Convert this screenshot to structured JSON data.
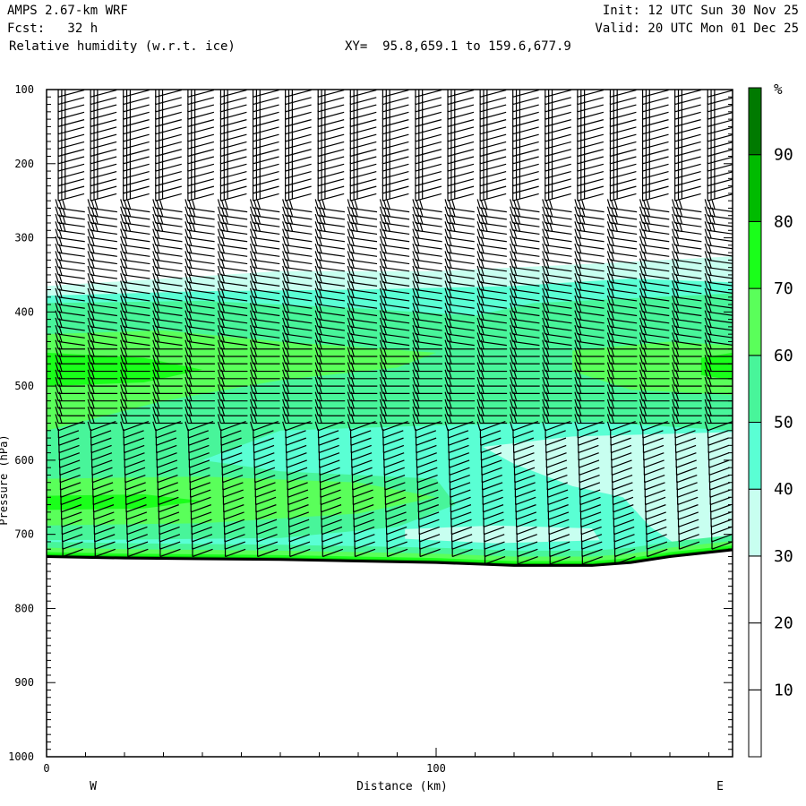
{
  "header": {
    "model": "AMPS 2.67-km WRF",
    "forecast": "Fcst:   32 h",
    "field": "Relative humidity (w.r.t. ice)",
    "xy": "XY=  95.8,659.1 to 159.6,677.9",
    "init": "Init: 12 UTC Sun 30 Nov 25",
    "valid": "Valid: 20 UTC Mon 01 Dec 25"
  },
  "chart_data": {
    "type": "heatmap",
    "title": "Relative humidity (w.r.t. ice)",
    "xlabel": "Distance (km)",
    "ylabel": "Pressure (hPa)",
    "xlim": [
      0,
      176
    ],
    "ylim": [
      1000,
      100
    ],
    "x_ticks": [
      0,
      100
    ],
    "x_minor_step": 10,
    "y_ticks": [
      100,
      200,
      300,
      400,
      500,
      600,
      700,
      800,
      900,
      1000
    ],
    "y_minor_step": 10,
    "left_end_label": "W",
    "right_end_label": "E",
    "colorbar": {
      "unit": "%",
      "tick_labels": [
        "10",
        "20",
        "30",
        "40",
        "50",
        "60",
        "70",
        "80",
        "90"
      ],
      "levels": [
        {
          "range": [
            0,
            10
          ],
          "color": "#ffffff"
        },
        {
          "range": [
            10,
            20
          ],
          "color": "#ffffff"
        },
        {
          "range": [
            20,
            30
          ],
          "color": "#ffffff"
        },
        {
          "range": [
            30,
            40
          ],
          "color": "#c8fff0"
        },
        {
          "range": [
            40,
            50
          ],
          "color": "#5affd4"
        },
        {
          "range": [
            50,
            60
          ],
          "color": "#48f59a"
        },
        {
          "range": [
            60,
            70
          ],
          "color": "#5aff5a"
        },
        {
          "range": [
            70,
            80
          ],
          "color": "#1aff1a"
        },
        {
          "range": [
            80,
            90
          ],
          "color": "#00bb00"
        },
        {
          "range": [
            90,
            100
          ],
          "color": "#007a00"
        }
      ]
    },
    "rh_regions": [
      {
        "level": 35,
        "polygon": [
          [
            0,
            365
          ],
          [
            30,
            355
          ],
          [
            60,
            345
          ],
          [
            100,
            345
          ],
          [
            140,
            335
          ],
          [
            176,
            325
          ],
          [
            176,
            780
          ],
          [
            0,
            780
          ]
        ]
      },
      {
        "level": 45,
        "polygon": [
          [
            0,
            378
          ],
          [
            40,
            372
          ],
          [
            80,
            370
          ],
          [
            120,
            365
          ],
          [
            150,
            355
          ],
          [
            176,
            360
          ],
          [
            176,
            780
          ],
          [
            0,
            780
          ]
        ]
      },
      {
        "level": 35,
        "polygon": [
          [
            112,
            582
          ],
          [
            135,
            568
          ],
          [
            176,
            562
          ],
          [
            176,
            700
          ],
          [
            162,
            715
          ],
          [
            155,
            690
          ],
          [
            148,
            650
          ],
          [
            135,
            635
          ],
          [
            120,
            605
          ]
        ]
      },
      {
        "level": 35,
        "polygon": [
          [
            92,
            693
          ],
          [
            115,
            688
          ],
          [
            140,
            692
          ],
          [
            142,
            708
          ],
          [
            115,
            712
          ],
          [
            92,
            706
          ]
        ]
      },
      {
        "level": 55,
        "polygon": [
          [
            0,
            388
          ],
          [
            40,
            385
          ],
          [
            80,
            395
          ],
          [
            110,
            405
          ],
          [
            125,
            388
          ],
          [
            176,
            375
          ],
          [
            176,
            560
          ],
          [
            140,
            548
          ],
          [
            100,
            553
          ],
          [
            60,
            560
          ],
          [
            40,
            600
          ],
          [
            60,
            615
          ],
          [
            100,
            625
          ],
          [
            105,
            660
          ],
          [
            90,
            690
          ],
          [
            60,
            705
          ],
          [
            0,
            708
          ]
        ]
      },
      {
        "level": 65,
        "polygon": [
          [
            0,
            430
          ],
          [
            30,
            425
          ],
          [
            60,
            440
          ],
          [
            100,
            455
          ],
          [
            90,
            475
          ],
          [
            60,
            492
          ],
          [
            30,
            520
          ],
          [
            0,
            560
          ]
        ]
      },
      {
        "level": 65,
        "polygon": [
          [
            0,
            625
          ],
          [
            40,
            622
          ],
          [
            80,
            630
          ],
          [
            100,
            650
          ],
          [
            80,
            672
          ],
          [
            40,
            685
          ],
          [
            0,
            688
          ]
        ]
      },
      {
        "level": 65,
        "polygon": [
          [
            135,
            452
          ],
          [
            160,
            440
          ],
          [
            176,
            445
          ],
          [
            176,
            512
          ],
          [
            150,
            505
          ],
          [
            135,
            480
          ]
        ]
      },
      {
        "level": 75,
        "polygon": [
          [
            0,
            455
          ],
          [
            25,
            462
          ],
          [
            40,
            478
          ],
          [
            25,
            495
          ],
          [
            0,
            500
          ]
        ]
      },
      {
        "level": 75,
        "polygon": [
          [
            0,
            648
          ],
          [
            25,
            646
          ],
          [
            40,
            655
          ],
          [
            25,
            665
          ],
          [
            0,
            667
          ]
        ]
      },
      {
        "level": 75,
        "polygon": [
          [
            168,
            462
          ],
          [
            176,
            455
          ],
          [
            176,
            492
          ],
          [
            168,
            485
          ]
        ]
      }
    ],
    "surface_bands": [
      {
        "depth_hPa": 20,
        "level": 55
      },
      {
        "depth_hPa": 12,
        "level": 65
      },
      {
        "depth_hPa": 6,
        "level": 75
      },
      {
        "depth_hPa": 3,
        "level": 85
      }
    ],
    "terrain_hPa": [
      [
        0,
        730
      ],
      [
        20,
        732
      ],
      [
        40,
        733
      ],
      [
        60,
        734
      ],
      [
        80,
        736
      ],
      [
        100,
        738
      ],
      [
        120,
        742
      ],
      [
        140,
        742
      ],
      [
        150,
        738
      ],
      [
        160,
        730
      ],
      [
        176,
        721
      ]
    ],
    "wind_barb_columns_km": [
      3,
      11.3,
      19.7,
      28,
      36.3,
      44.7,
      53,
      61.3,
      69.7,
      78,
      86.3,
      94.7,
      103,
      111.3,
      119.7,
      128,
      136.3,
      144.7,
      153,
      161.3,
      169.7
    ],
    "wind_barb_levels_hPa": {
      "start": 110,
      "step": 10
    }
  }
}
